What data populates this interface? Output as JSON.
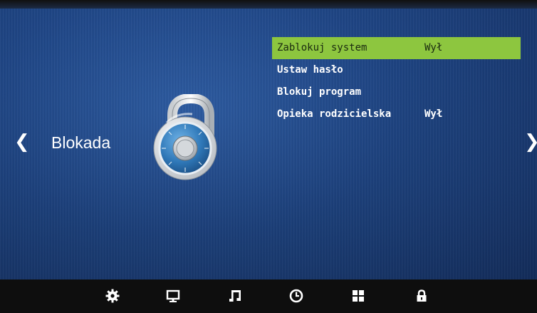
{
  "nav": {
    "left_arrow": "❮",
    "right_arrow": "❯"
  },
  "section": {
    "title": "Blokada",
    "icon": "padlock-combination-icon"
  },
  "menu": {
    "items": [
      {
        "label": "Zablokuj system",
        "value": "Wył",
        "selected": true
      },
      {
        "label": "Ustaw hasło",
        "value": ""
      },
      {
        "label": "Blokuj program",
        "value": ""
      },
      {
        "label": "Opieka rodzicielska",
        "value": "Wył"
      }
    ]
  },
  "bottom_bar": {
    "icons": [
      "settings-gear-icon",
      "monitor-icon",
      "music-note-icon",
      "clock-icon",
      "grid-apps-icon",
      "lock-icon"
    ],
    "active": "lock-icon"
  },
  "colors": {
    "selected_highlight": "#8dc63f",
    "background": "#1e4585",
    "text": "#ffffff"
  }
}
